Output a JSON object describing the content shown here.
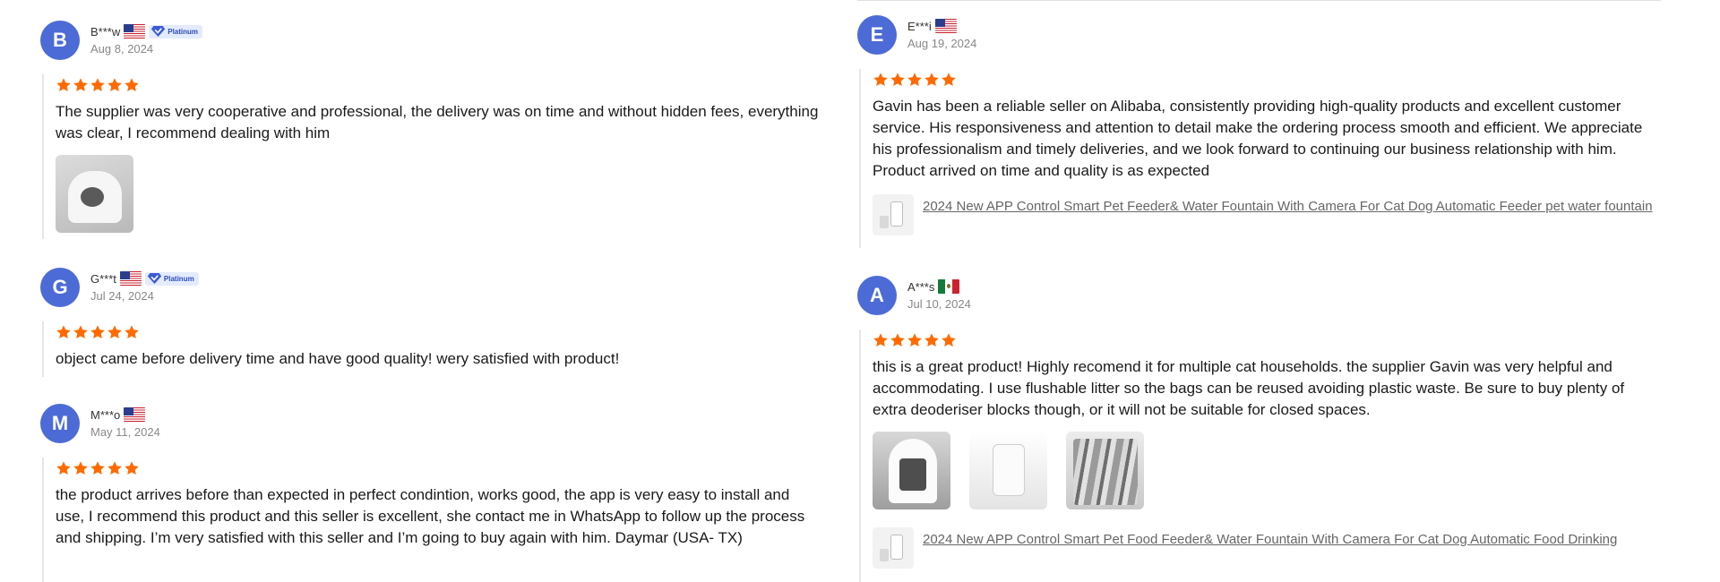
{
  "reviews_left": [
    {
      "initial": "B",
      "name": "B***w",
      "badge": "Platinum",
      "date": "Aug 8, 2024",
      "rating": 5,
      "text": "The supplier was very cooperative and professional, the delivery was on time and without hidden fees, everything was clear, I recommend dealing with him"
    },
    {
      "initial": "G",
      "name": "G***t",
      "badge": "Platinum",
      "date": "Jul 24, 2024",
      "rating": 5,
      "text": "object came before delivery time and have good quality! wery satisfied with product!"
    },
    {
      "initial": "M",
      "name": "M***o",
      "date": "May 11, 2024",
      "rating": 5,
      "text": "the product arrives before than expected in perfect condintion, works good, the app is very easy to install and use, I recommend this product and this seller is excellent, she contact me in WhatsApp to follow up the process and shipping. I’m very satisfied with this seller and I’m going to buy again with him. Daymar (USA- TX)"
    }
  ],
  "reviews_right": [
    {
      "initial": "E",
      "name": "E***i",
      "date": "Aug 19, 2024",
      "rating": 5,
      "text": "Gavin has been a reliable seller on Alibaba, consistently providing high-quality products and excellent customer service. His responsiveness and attention to detail make the ordering process smooth and efficient. We appreciate his professionalism and timely deliveries, and we look forward to continuing our business relationship with him. Product arrived on time and quality is as expected",
      "product": "2024 New APP Control Smart Pet Feeder& Water Fountain With Camera For Cat Dog Automatic Feeder pet water fountain"
    },
    {
      "initial": "A",
      "name": "A***s",
      "date": "Jul 10, 2024",
      "rating": 5,
      "text": "this is a great product! Highly recomend it for multiple cat households. the supplier Gavin was very helpful and accommodating. I use flushable litter so the bags can be reused avoiding plastic waste. Be sure to buy plenty of extra deoderiser blocks though, or it will not be suitable for closed spaces.",
      "product": "2024 New APP Control Smart Pet Food Feeder& Water Fountain With Camera For Cat Dog Automatic Food Drinking"
    }
  ],
  "colors": {
    "avatar": "#4d6bd6",
    "star": "#ff6a00",
    "badge_bg": "#e4ebff",
    "badge_text": "#2a4ab8",
    "link": "#666666"
  }
}
